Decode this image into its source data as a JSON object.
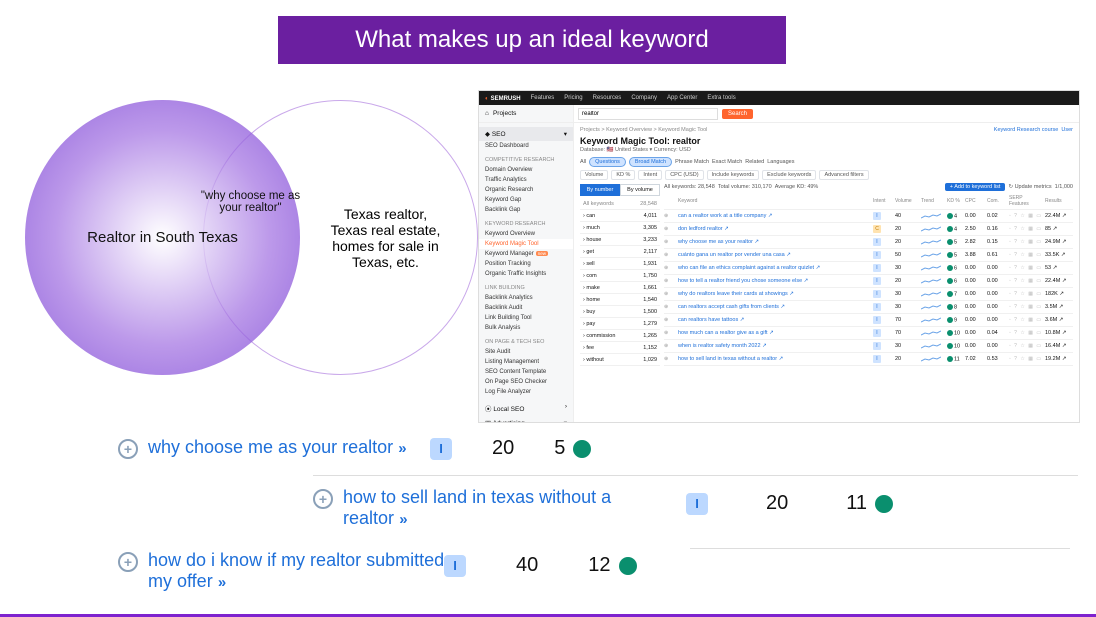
{
  "title": "What makes up an ideal keyword",
  "venn": {
    "left": "Realtor in South Texas",
    "overlap": "\"why choose me as your realtor\"",
    "right": "Texas realtor, Texas real estate, homes for sale in Texas, etc."
  },
  "keyword_entries": [
    {
      "text": "why choose me as your realtor",
      "intent": "I",
      "volume": 20,
      "kd": 5
    },
    {
      "text": "how to sell land in texas without a realtor",
      "intent": "I",
      "volume": 20,
      "kd": 11
    },
    {
      "text": "how do i know if my realtor submitted my offer",
      "intent": "I",
      "volume": 40,
      "kd": 12
    }
  ],
  "semrush": {
    "brand": "SEMRUSH",
    "topnav": [
      "Features",
      "Pricing",
      "Resources",
      "Company",
      "App Center",
      "Extra tools"
    ],
    "sidebar_projects": "Projects",
    "sidebar_seo": "SEO",
    "sidebar": [
      {
        "group": "",
        "items": [
          "SEO Dashboard"
        ]
      },
      {
        "group": "COMPETITIVE RESEARCH",
        "items": [
          "Domain Overview",
          "Traffic Analytics",
          "Organic Research",
          "Keyword Gap",
          "Backlink Gap"
        ]
      },
      {
        "group": "KEYWORD RESEARCH",
        "items": [
          "Keyword Overview",
          "Keyword Magic Tool",
          "Keyword Manager",
          "Position Tracking",
          "Organic Traffic Insights"
        ]
      },
      {
        "group": "LINK BUILDING",
        "items": [
          "Backlink Analytics",
          "Backlink Audit",
          "Link Building Tool",
          "Bulk Analysis"
        ]
      },
      {
        "group": "ON PAGE & TECH SEO",
        "items": [
          "Site Audit",
          "Listing Management",
          "SEO Content Template",
          "On Page SEO Checker",
          "Log File Analyzer"
        ]
      }
    ],
    "sidebar_localseo": "Local SEO",
    "sidebar_advertising": "Advertising",
    "search_value": "realtor",
    "search_btn": "Search",
    "breadcrumbs": "Projects  >  Keyword Overview  >  Keyword Magic Tool",
    "links_right": [
      "Keyword Research course",
      "User"
    ],
    "page_title": "Keyword Magic Tool: realtor",
    "database_line": "Database: 🇺🇸 United States ▾   Currency: USD",
    "match_tabs": {
      "all": "All",
      "questions": "Questions",
      "broad": "Broad Match",
      "phrase": "Phrase Match",
      "exact": "Exact Match",
      "related": "Related",
      "languages": "Languages"
    },
    "filters": [
      "Volume",
      "KD %",
      "Intent",
      "CPC (USD)",
      "Include keywords",
      "Exclude keywords",
      "Advanced filters"
    ],
    "group_tabs": {
      "num": "By number",
      "vol": "By volume"
    },
    "groups_header": {
      "label": "All keywords",
      "count": "28,548"
    },
    "groups": [
      {
        "w": "can",
        "n": "4,011"
      },
      {
        "w": "much",
        "n": "3,305"
      },
      {
        "w": "house",
        "n": "3,233"
      },
      {
        "w": "get",
        "n": "2,117"
      },
      {
        "w": "sell",
        "n": "1,931"
      },
      {
        "w": "com",
        "n": "1,750"
      },
      {
        "w": "make",
        "n": "1,661"
      },
      {
        "w": "home",
        "n": "1,540"
      },
      {
        "w": "buy",
        "n": "1,500"
      },
      {
        "w": "pay",
        "n": "1,279"
      },
      {
        "w": "commission",
        "n": "1,265"
      },
      {
        "w": "fee",
        "n": "1,152"
      },
      {
        "w": "without",
        "n": "1,029"
      }
    ],
    "results_summary": {
      "all": "All keywords: 28,548",
      "total": "Total volume: 310,170",
      "avg": "Average KD: 49%"
    },
    "add_btn": "+ Add to keyword list",
    "update_btn": "Update metrics",
    "update_count": "1/1,000",
    "cols": [
      "",
      "Keyword",
      "Intent",
      "Volume",
      "Trend",
      "KD %",
      "CPC",
      "Com.",
      "SERP Features",
      "Results"
    ],
    "rows": [
      {
        "kw": "can a realtor work at a title company",
        "intent": "I",
        "vol": 40,
        "kd": 4,
        "cpc": "0.00",
        "com": "0.02",
        "serp": "⋯",
        "res": "22.4M"
      },
      {
        "kw": "don ledford realtor",
        "intent": "C",
        "vol": 20,
        "kd": 4,
        "cpc": "2.50",
        "com": "0.16",
        "serp": "⋯",
        "res": "85"
      },
      {
        "kw": "why choose me as your realtor",
        "intent": "I",
        "vol": 20,
        "kd": 5,
        "cpc": "2.82",
        "com": "0.15",
        "serp": "⋯",
        "res": "24.9M"
      },
      {
        "kw": "cuánto gana un realtor por vender una casa",
        "intent": "I",
        "vol": 50,
        "kd": 5,
        "cpc": "3.88",
        "com": "0.61",
        "serp": "⋯",
        "res": "33.5K"
      },
      {
        "kw": "who can file an ethics complaint against a realtor quizlet",
        "intent": "I",
        "vol": 30,
        "kd": 6,
        "cpc": "0.00",
        "com": "0.00",
        "serp": "⋯",
        "res": "53"
      },
      {
        "kw": "how to tell a realtor friend you chose someone else",
        "intent": "I",
        "vol": 20,
        "kd": 6,
        "cpc": "0.00",
        "com": "0.00",
        "serp": "⋯",
        "res": "22.4M"
      },
      {
        "kw": "why do realtors leave their cards at showings",
        "intent": "I",
        "vol": 30,
        "kd": 7,
        "cpc": "0.00",
        "com": "0.00",
        "serp": "⋯",
        "res": "182K"
      },
      {
        "kw": "can realtors accept cash gifts from clients",
        "intent": "I",
        "vol": 30,
        "kd": 8,
        "cpc": "0.00",
        "com": "0.00",
        "serp": "⋯",
        "res": "3.5M"
      },
      {
        "kw": "can realtors have tattoos",
        "intent": "I",
        "vol": 70,
        "kd": 9,
        "cpc": "0.00",
        "com": "0.00",
        "serp": "⋯",
        "res": "3.6M"
      },
      {
        "kw": "how much can a realtor give as a gift",
        "intent": "I",
        "vol": 70,
        "kd": 10,
        "cpc": "0.00",
        "com": "0.04",
        "serp": "⋯",
        "res": "10.8M"
      },
      {
        "kw": "when is realtor safety month 2022",
        "intent": "I",
        "vol": 30,
        "kd": 10,
        "cpc": "0.00",
        "com": "0.00",
        "serp": "⋯",
        "res": "16.4M"
      },
      {
        "kw": "how to sell land in texas without a realtor",
        "intent": "I",
        "vol": 20,
        "kd": 11,
        "cpc": "7.02",
        "com": "0.53",
        "serp": "⋯",
        "res": "19.2M"
      }
    ]
  }
}
